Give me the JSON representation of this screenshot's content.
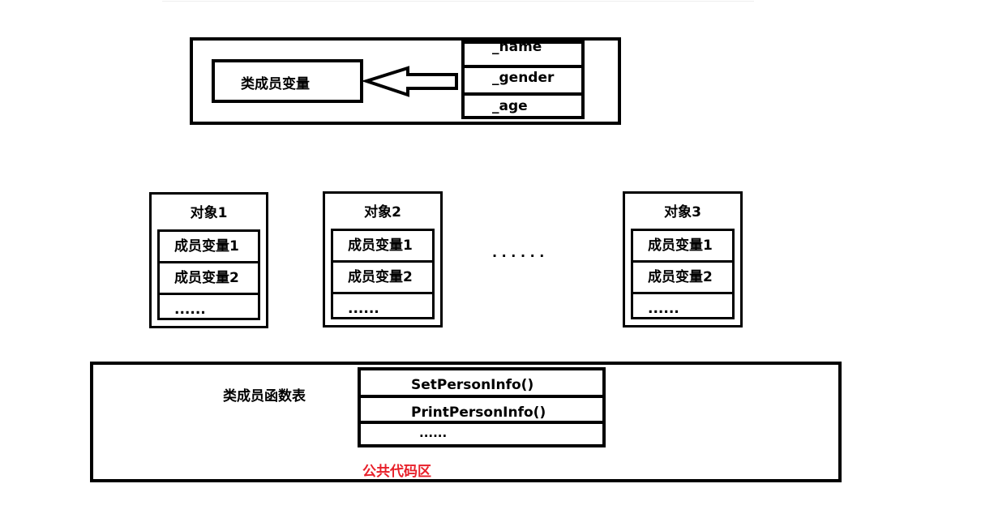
{
  "class_box": {
    "member_vars_label": "类成员变量",
    "fields": [
      "_name",
      "_gender",
      "_age"
    ]
  },
  "objects": [
    {
      "title": "对象1",
      "rows": [
        "成员变量1",
        "成员变量2",
        "......"
      ]
    },
    {
      "title": "对象2",
      "rows": [
        "成员变量1",
        "成员变量2",
        "......"
      ]
    },
    {
      "title": "对象3",
      "rows": [
        "成员变量1",
        "成员变量2",
        "......"
      ]
    }
  ],
  "ellipsis": "· · · · · ·",
  "code_area": {
    "func_table_label": "类成员函数表",
    "functions": [
      "SetPersonInfo()",
      "PrintPersonInfo()",
      "......"
    ],
    "area_label": "公共代码区",
    "area_label_color": "#e8202a"
  }
}
